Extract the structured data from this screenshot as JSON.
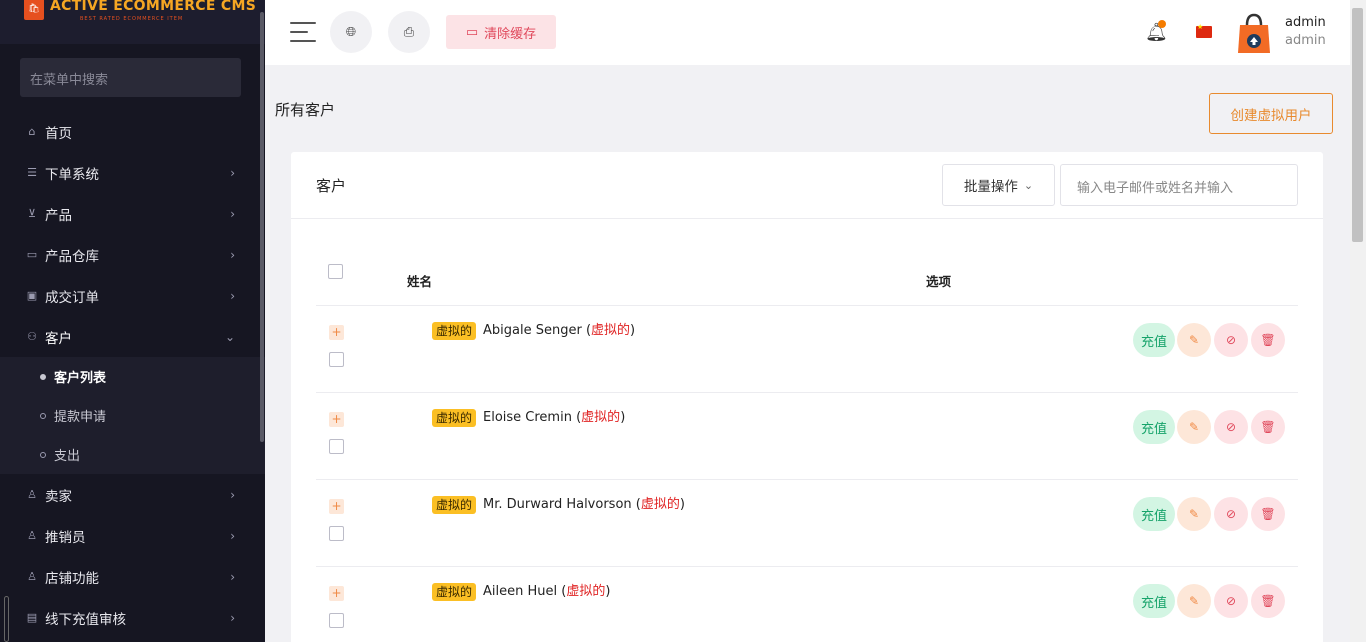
{
  "brand": {
    "title": "ACTIVE ECOMMERCE CMS",
    "subtitle": "BEST RATED ECOMMERCE ITEM"
  },
  "sidebar": {
    "search_placeholder": "在菜单中搜索",
    "items": [
      {
        "label": "首页",
        "icon": "home-icon",
        "has_children": false
      },
      {
        "label": "下单系统",
        "icon": "list-icon",
        "has_children": true
      },
      {
        "label": "产品",
        "icon": "cart-icon",
        "has_children": true
      },
      {
        "label": "产品仓库",
        "icon": "archive-icon",
        "has_children": true
      },
      {
        "label": "成交订单",
        "icon": "ticket-icon",
        "has_children": true
      },
      {
        "label": "客户",
        "icon": "users-icon",
        "has_children": true,
        "expanded": true,
        "children": [
          {
            "label": "客户列表",
            "active": true
          },
          {
            "label": "提款申请",
            "active": false
          },
          {
            "label": "支出",
            "active": false
          }
        ]
      },
      {
        "label": "卖家",
        "icon": "user-icon",
        "has_children": true
      },
      {
        "label": "推销员",
        "icon": "user-icon",
        "has_children": true
      },
      {
        "label": "店铺功能",
        "icon": "user-icon",
        "has_children": true
      },
      {
        "label": "线下充值审核",
        "icon": "card-icon",
        "has_children": true
      }
    ]
  },
  "topbar": {
    "clear_cache_label": "清除缓存",
    "user_name": "admin",
    "user_role": "admin",
    "language": "zh-CN"
  },
  "page": {
    "title": "所有客户",
    "create_button": "创建虚拟用户"
  },
  "card": {
    "title": "客户",
    "bulk_action": "批量操作",
    "search_placeholder": "输入电子邮件或姓名并输入"
  },
  "table": {
    "columns": [
      "姓名",
      "选项"
    ],
    "rows": [
      {
        "badge": "虚拟的",
        "name": "Abigale Senger",
        "tag": "虚拟的"
      },
      {
        "badge": "虚拟的",
        "name": "Eloise Cremin",
        "tag": "虚拟的"
      },
      {
        "badge": "虚拟的",
        "name": "Mr. Durward Halvorson",
        "tag": "虚拟的"
      },
      {
        "badge": "虚拟的",
        "name": "Aileen Huel",
        "tag": "虚拟的"
      }
    ],
    "actions": {
      "recharge": "充值"
    }
  },
  "colors": {
    "accent": "#e88a2e",
    "sidebar": "#161622",
    "badge": "#fbbf24",
    "danger": "#e0475a",
    "success": "#16a36a"
  }
}
